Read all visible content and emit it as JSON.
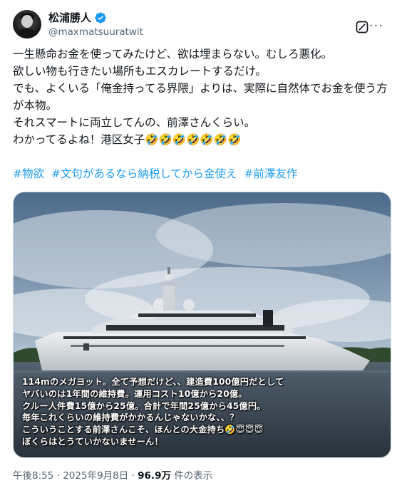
{
  "author": {
    "display_name": "松浦勝人",
    "handle": "@maxmatsuuratwit"
  },
  "tweet": {
    "text": "一生懸命お金を使ってみたけど、欲は埋まらない。むしろ悪化。\n欲しい物も行きたい場所もエスカレートするだけ。\nでも、よくいる「俺金持ってる界隈」よりは、実際に自然体でお金を使う方が本物。\nそれスマートに両立してんの、前澤さんくらい。\nわかってるよね！港区女子🤣🤣🤣🤣🤣🤣🤣",
    "hashtags": [
      "#物欲",
      "#文句があるなら納税してから金使え",
      "#前澤友作"
    ]
  },
  "image": {
    "overlay_text": "114mのメガヨット。全て予想だけど、、建造費100億円だとして\nヤバいのは1年間の維持費。運用コスト10億から20億。\nクルー人件費15億から25億。合計で年間25億から45億円。\n毎年これくらいの維持費がかかるんじゃないかな、、？\nこういうことする前澤さんこそ、ほんとの大金持ち🤣😇😇😇\nぼくらはとうていかないませーん！"
  },
  "meta": {
    "time": "午後8:55",
    "date": "2025年9月8日",
    "views": "96.9万",
    "views_label": "件の表示"
  },
  "icons": {
    "verified": "verified-badge-icon",
    "grok": "grok-icon",
    "more": "more-options-icon"
  },
  "colors": {
    "link": "#1d9bf0",
    "secondary": "#536471",
    "verified": "#1d9bf0"
  }
}
